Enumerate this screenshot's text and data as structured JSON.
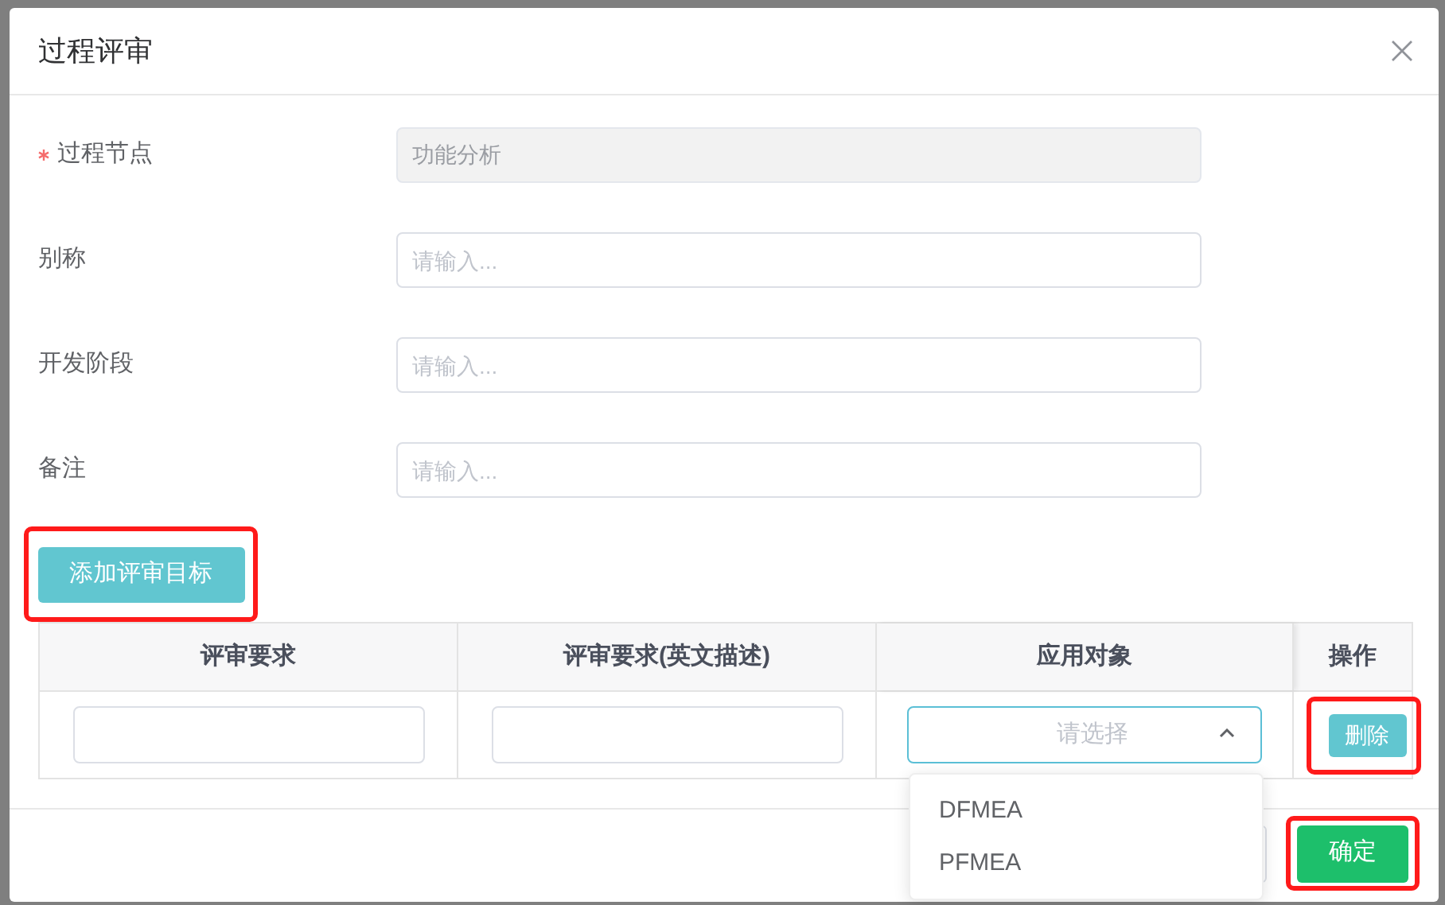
{
  "dialog": {
    "title": "过程评审"
  },
  "form_fields": [
    {
      "label": "过程节点",
      "required": true,
      "disabled": true,
      "value": "功能分析"
    },
    {
      "label": "别称",
      "required": false,
      "disabled": false,
      "placeholder": "请输入..."
    },
    {
      "label": "开发阶段",
      "required": false,
      "disabled": false,
      "placeholder": "请输入..."
    },
    {
      "label": "备注",
      "required": false,
      "disabled": false,
      "placeholder": "请输入..."
    }
  ],
  "add_button": {
    "label": "添加评审目标",
    "highlighted": true
  },
  "table": {
    "columns": [
      "评审要求",
      "评审要求(英文描述)",
      "应用对象",
      "操作"
    ],
    "rows": [
      {
        "select": {
          "placeholder": "请选择",
          "expanded": true,
          "options": [
            "DFMEA",
            "PFMEA"
          ]
        },
        "action": {
          "label": "删除",
          "highlighted": true
        }
      }
    ]
  },
  "footer": {
    "confirm": {
      "label": "确定",
      "highlighted": true
    }
  }
}
